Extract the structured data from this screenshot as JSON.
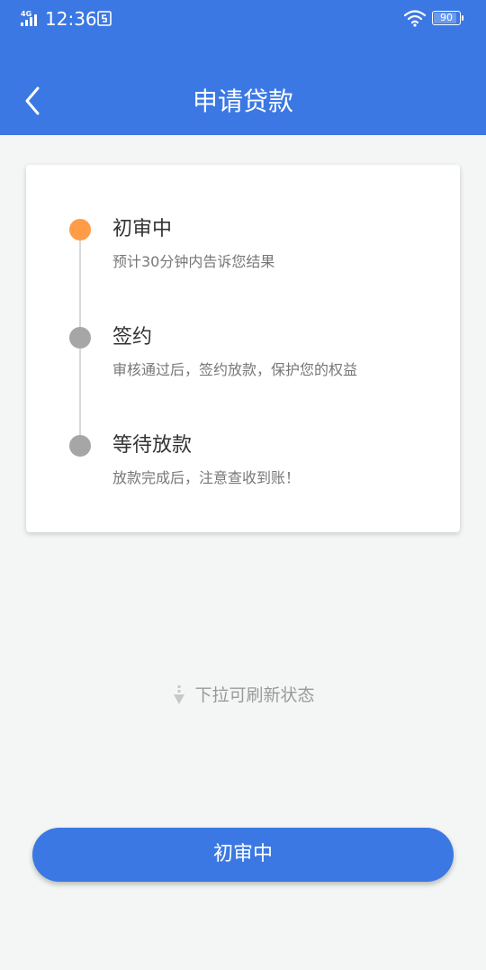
{
  "status_bar": {
    "network": "4G",
    "time": "12:36",
    "battery": "90",
    "battery_level": 0.9
  },
  "header": {
    "title": "申请贷款",
    "back_icon": "chevron-left-icon"
  },
  "progress": {
    "steps": [
      {
        "title": "初审中",
        "desc": "预计30分钟内告诉您结果",
        "state": "active"
      },
      {
        "title": "签约",
        "desc": "审核通过后，签约放款，保护您的权益",
        "state": "pending"
      },
      {
        "title": "等待放款",
        "desc": "放款完成后，注意查收到账！",
        "state": "pending"
      }
    ]
  },
  "pull_hint": {
    "text": "下拉可刷新状态",
    "icon": "arrow-down-icon"
  },
  "action_button": {
    "label": "初审中"
  },
  "colors": {
    "primary": "#3b78e3",
    "active_dot": "#ff9c47",
    "pending_dot": "#a6a6a6",
    "background": "#f4f6f5"
  }
}
